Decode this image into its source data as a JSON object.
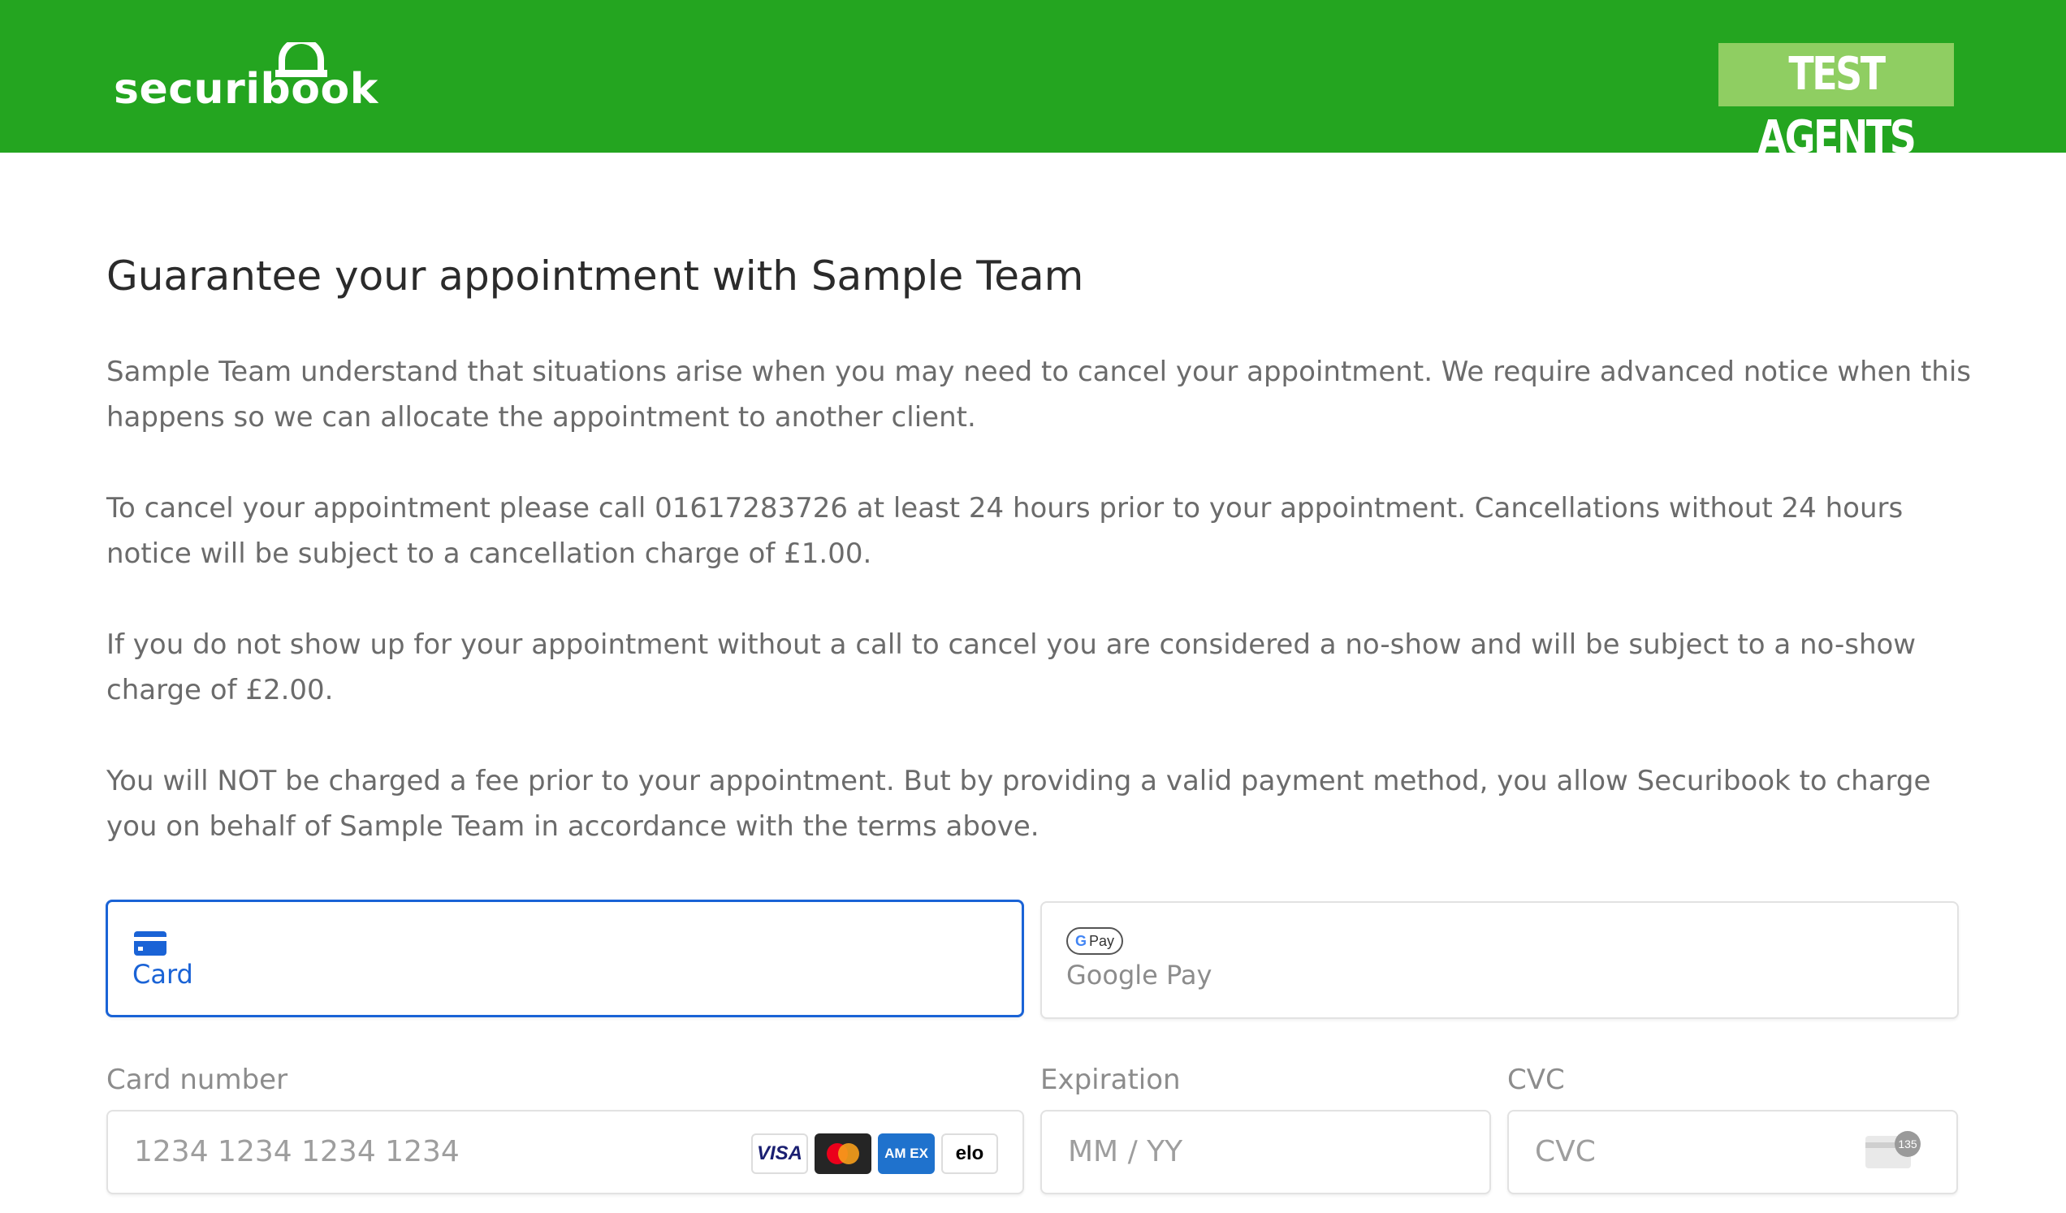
{
  "header": {
    "logo_text": "securibook",
    "badge_text": "TEST AGENTS",
    "brand_color": "#24a520"
  },
  "main": {
    "title": "Guarantee your appointment with Sample Team",
    "paragraphs": [
      "Sample Team understand that situations arise when you may need to cancel your appointment. We require advanced notice when this happens so we can allocate the appointment to another client.",
      "To cancel your appointment please call 01617283726 at least 24 hours prior to your appointment. Cancellations without 24 hours notice will be subject to a cancellation charge of £1.00.",
      "If you do not show up for your appointment without a call to cancel you are considered a no-show and will be subject to a no-show charge of £2.00.",
      "You will NOT be charged a fee prior to your appointment. But by providing a valid payment method, you allow Securibook to charge you on behalf of Sample Team in accordance with the terms above."
    ]
  },
  "payment": {
    "tabs": [
      {
        "label": "Card",
        "icon": "credit-card-icon",
        "active": true
      },
      {
        "label": "Google Pay",
        "icon": "google-pay-icon",
        "active": false
      }
    ],
    "google_pay_mark": "Pay",
    "card_number": {
      "label": "Card number",
      "placeholder": "1234 1234 1234 1234",
      "value": ""
    },
    "expiration": {
      "label": "Expiration",
      "placeholder": "MM / YY",
      "value": ""
    },
    "cvc": {
      "label": "CVC",
      "placeholder": "CVC",
      "value": "",
      "icon_text": "135"
    },
    "card_brands": [
      {
        "name": "visa",
        "text": "VISA"
      },
      {
        "name": "mastercard",
        "text": ""
      },
      {
        "name": "amex",
        "text": "AM EX"
      },
      {
        "name": "elo",
        "text": "elo"
      }
    ],
    "accent_color": "#1a63d6"
  }
}
